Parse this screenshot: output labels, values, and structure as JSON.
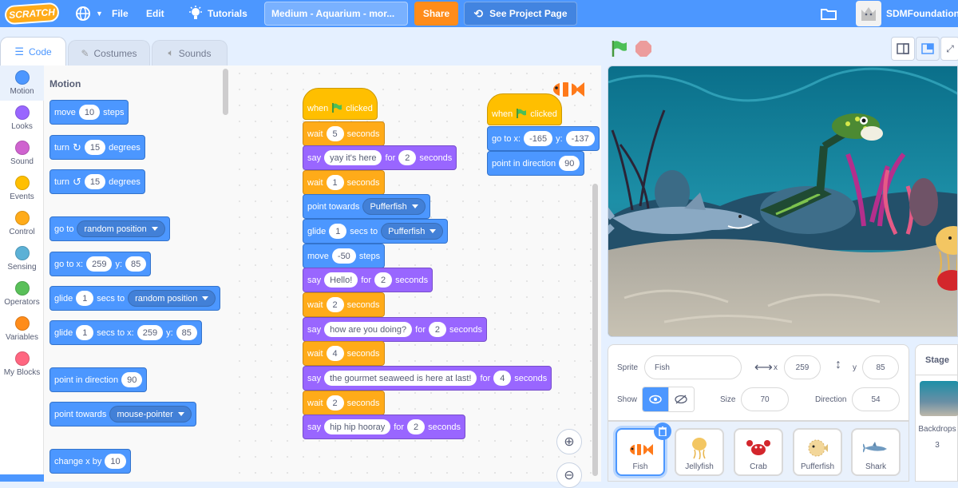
{
  "menu": {
    "logo": "SCRATCH",
    "file": "File",
    "edit": "Edit",
    "tutorials": "Tutorials",
    "project_title": "Medium - Aquarium - mor...",
    "share": "Share",
    "see_project_page": "See Project Page",
    "username": "SDMFoundation"
  },
  "tabs": {
    "code": "Code",
    "costumes": "Costumes",
    "sounds": "Sounds"
  },
  "categories": [
    {
      "label": "Motion",
      "color": "#4c97ff"
    },
    {
      "label": "Looks",
      "color": "#9966ff"
    },
    {
      "label": "Sound",
      "color": "#cf63cf"
    },
    {
      "label": "Events",
      "color": "#ffbf00"
    },
    {
      "label": "Control",
      "color": "#ffab19"
    },
    {
      "label": "Sensing",
      "color": "#5cb1d6"
    },
    {
      "label": "Operators",
      "color": "#59c059"
    },
    {
      "label": "Variables",
      "color": "#ff8c1a"
    },
    {
      "label": "My Blocks",
      "color": "#ff6680"
    }
  ],
  "palette": {
    "title": "Motion",
    "move": {
      "a": "move",
      "v": "10",
      "b": "steps"
    },
    "turn_right": {
      "a": "turn",
      "v": "15",
      "b": "degrees"
    },
    "turn_left": {
      "a": "turn",
      "v": "15",
      "b": "degrees"
    },
    "go_to": {
      "a": "go to",
      "dd": "random position"
    },
    "go_to_xy": {
      "a": "go to x:",
      "x": "259",
      "ylabel": "y:",
      "y": "85"
    },
    "glide_to": {
      "a": "glide",
      "v": "1",
      "b": "secs to",
      "dd": "random position"
    },
    "glide_xy": {
      "a": "glide",
      "v": "1",
      "b": "secs to x:",
      "x": "259",
      "ylabel": "y:",
      "y": "85"
    },
    "point_dir": {
      "a": "point in direction",
      "v": "90"
    },
    "point_towards": {
      "a": "point towards",
      "dd": "mouse-pointer"
    },
    "change_x": {
      "a": "change x by",
      "v": "10"
    }
  },
  "script1": {
    "hat": {
      "a": "when",
      "b": "clicked"
    },
    "wait1": {
      "a": "wait",
      "v": "5",
      "b": "seconds"
    },
    "say1": {
      "a": "say",
      "msg": "yay it's here",
      "for": "for",
      "v": "2",
      "b": "seconds"
    },
    "wait2": {
      "a": "wait",
      "v": "1",
      "b": "seconds"
    },
    "point_towards": {
      "a": "point towards",
      "dd": "Pufferfish"
    },
    "glide": {
      "a": "glide",
      "v": "1",
      "b": "secs to",
      "dd": "Pufferfish"
    },
    "move": {
      "a": "move",
      "v": "-50",
      "b": "steps"
    },
    "say2": {
      "a": "say",
      "msg": "Hello!",
      "for": "for",
      "v": "2",
      "b": "seconds"
    },
    "wait3": {
      "a": "wait",
      "v": "2",
      "b": "seconds"
    },
    "say3": {
      "a": "say",
      "msg": "how are you doing?",
      "for": "for",
      "v": "2",
      "b": "seconds"
    },
    "wait4": {
      "a": "wait",
      "v": "4",
      "b": "seconds"
    },
    "say4": {
      "a": "say",
      "msg": "the  gourmet seaweed is here at last!",
      "for": "for",
      "v": "4",
      "b": "seconds"
    },
    "wait5": {
      "a": "wait",
      "v": "2",
      "b": "seconds"
    },
    "say5": {
      "a": "say",
      "msg": "hip hip hooray",
      "for": "for",
      "v": "2",
      "b": "seconds"
    }
  },
  "script2": {
    "hat": {
      "a": "when",
      "b": "clicked"
    },
    "goto": {
      "a": "go to x:",
      "x": "-165",
      "ylabel": "y:",
      "y": "-137"
    },
    "point": {
      "a": "point in direction",
      "v": "90"
    }
  },
  "sprite_info": {
    "sprite_label": "Sprite",
    "sprite_name": "Fish",
    "x_label": "x",
    "x": "259",
    "y_label": "y",
    "y": "85",
    "show_label": "Show",
    "size_label": "Size",
    "size": "70",
    "direction_label": "Direction",
    "direction": "54"
  },
  "sprites": [
    {
      "name": "Fish",
      "selected": true
    },
    {
      "name": "Jellyfish"
    },
    {
      "name": "Crab"
    },
    {
      "name": "Pufferfish"
    },
    {
      "name": "Shark"
    }
  ],
  "stage_panel": {
    "title": "Stage",
    "backdrops_label": "Backdrops",
    "backdrops_count": "3"
  },
  "colors": {
    "menubar": "#4c97ff",
    "motion": "#4c97ff",
    "looks": "#9966ff",
    "events": "#ffbf00",
    "control": "#ffab19",
    "share": "#ff8c1a"
  }
}
